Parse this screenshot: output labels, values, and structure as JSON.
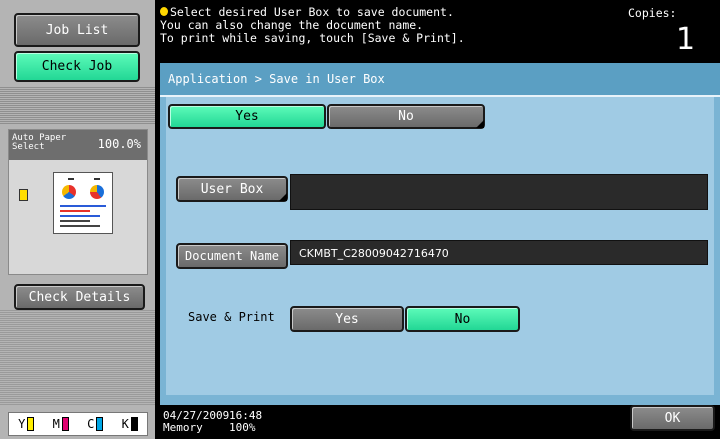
{
  "sidebar": {
    "job_list": "Job List",
    "check_job": "Check Job",
    "preview": {
      "paper_label_1": "Auto Paper",
      "paper_label_2": "Select",
      "zoom": "100.0%"
    },
    "check_details": "Check Details",
    "toner": [
      "Y",
      "M",
      "C",
      "K"
    ]
  },
  "message": {
    "line1": "Select desired User Box to save document.",
    "line2": "You can also change the document name.",
    "line3": "To print while saving, touch [Save & Print]."
  },
  "copies": {
    "label": "Copies:",
    "value": "1"
  },
  "breadcrumb": "Application > Save in User Box",
  "top_toggle": {
    "yes": "Yes",
    "no": "No"
  },
  "user_box": {
    "label": "User Box",
    "value": ""
  },
  "document_name": {
    "label": "Document Name",
    "value": "CKMBT_C28009042716470"
  },
  "save_print": {
    "label": "Save & Print",
    "yes": "Yes",
    "no": "No"
  },
  "status": {
    "date": "04/27/2009",
    "time": "16:48",
    "memory_label": "Memory",
    "memory_value": "100%"
  },
  "ok_label": "OK",
  "colors": {
    "green": "#3df0a8",
    "panel_blue": "#a0cbe4",
    "header_blue": "#5b9fc3"
  }
}
